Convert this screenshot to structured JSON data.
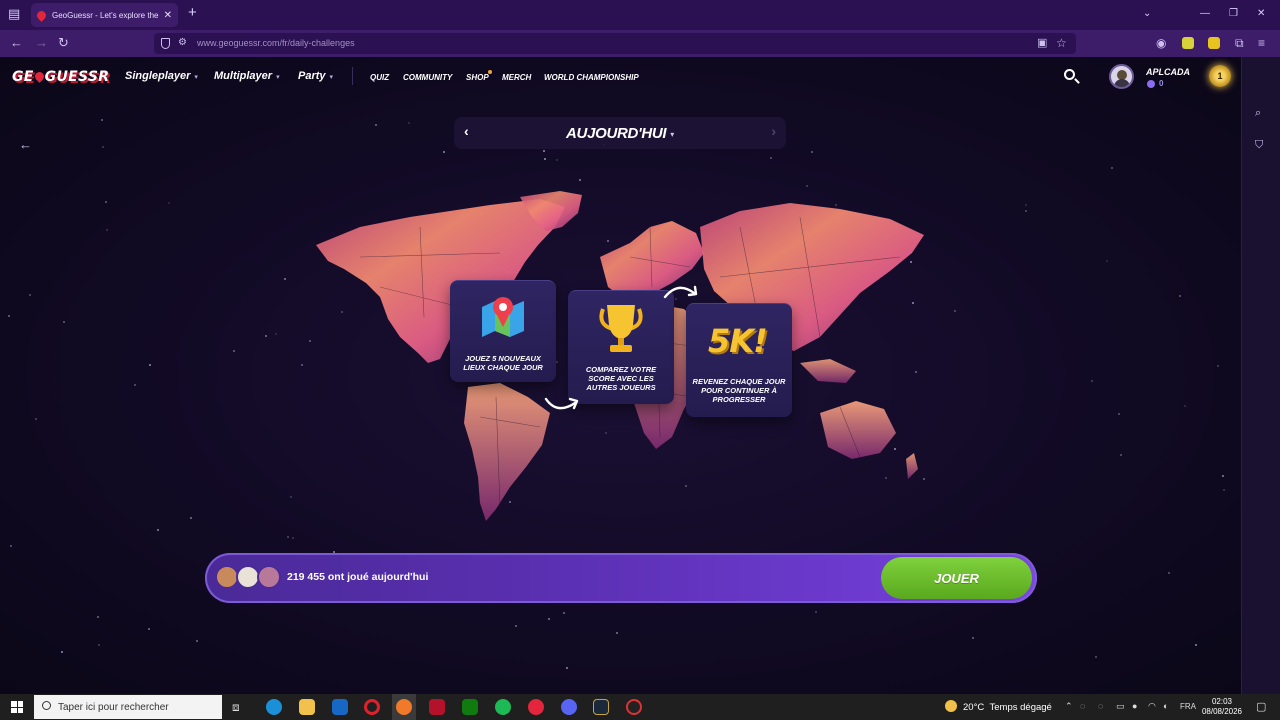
{
  "browser": {
    "tab_title": "GeoGuessr - Let's explore the w",
    "tab_close": "✕",
    "new_tab": "+",
    "url": "www.geoguessr.com/fr/daily-challenges"
  },
  "header": {
    "logo_left": "GE",
    "logo_right": "GUESSR",
    "nav_main": [
      {
        "label": "Singleplayer"
      },
      {
        "label": "Multiplayer"
      },
      {
        "label": "Party"
      }
    ],
    "nav_small": [
      {
        "label": "QUIZ"
      },
      {
        "label": "COMMUNITY"
      },
      {
        "label": "SHOP"
      },
      {
        "label": "MERCH"
      },
      {
        "label": "WORLD CHAMPIONSHIP"
      }
    ],
    "username": "APLCADA",
    "coins": "0",
    "level": "1"
  },
  "challenge": {
    "day_label": "AUJOURD'HUI",
    "cards": [
      {
        "text": "JOUEZ 5 NOUVEAUX LIEUX CHAQUE JOUR",
        "icon": "map-pin-icon"
      },
      {
        "text": "COMPAREZ VOTRE SCORE AVEC LES AUTRES JOUEURS",
        "icon": "trophy-icon"
      },
      {
        "text": "REVENEZ CHAQUE JOUR POUR CONTINUER À PROGRESSER",
        "icon": "5k-badge-icon",
        "badge": "5K!"
      }
    ],
    "players_text": "219 455 ont joué aujourd'hui",
    "play_label": "JOUER"
  },
  "taskbar": {
    "search_placeholder": "Taper ici pour rechercher",
    "temperature": "20°C",
    "weather_text": "Temps dégagé",
    "language": "FRA",
    "time": "02:03",
    "date": "08/08/2026"
  },
  "colors": {
    "brand_red": "#e3263b",
    "play_green": "#6cc02b",
    "bar_purple": "#5a2fb0",
    "browser_purple": "#3d1d69"
  }
}
